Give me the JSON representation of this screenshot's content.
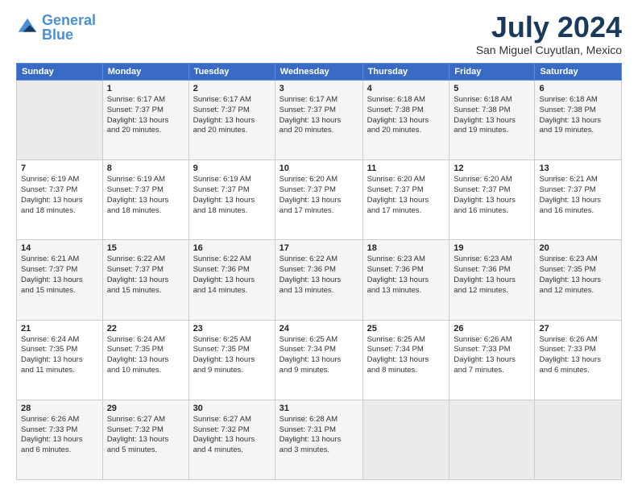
{
  "header": {
    "logo_general": "General",
    "logo_blue": "Blue",
    "month_title": "July 2024",
    "location": "San Miguel Cuyutlan, Mexico"
  },
  "weekdays": [
    "Sunday",
    "Monday",
    "Tuesday",
    "Wednesday",
    "Thursday",
    "Friday",
    "Saturday"
  ],
  "weeks": [
    [
      {
        "day": "",
        "info": ""
      },
      {
        "day": "1",
        "info": "Sunrise: 6:17 AM\nSunset: 7:37 PM\nDaylight: 13 hours\nand 20 minutes."
      },
      {
        "day": "2",
        "info": "Sunrise: 6:17 AM\nSunset: 7:37 PM\nDaylight: 13 hours\nand 20 minutes."
      },
      {
        "day": "3",
        "info": "Sunrise: 6:17 AM\nSunset: 7:37 PM\nDaylight: 13 hours\nand 20 minutes."
      },
      {
        "day": "4",
        "info": "Sunrise: 6:18 AM\nSunset: 7:38 PM\nDaylight: 13 hours\nand 20 minutes."
      },
      {
        "day": "5",
        "info": "Sunrise: 6:18 AM\nSunset: 7:38 PM\nDaylight: 13 hours\nand 19 minutes."
      },
      {
        "day": "6",
        "info": "Sunrise: 6:18 AM\nSunset: 7:38 PM\nDaylight: 13 hours\nand 19 minutes."
      }
    ],
    [
      {
        "day": "7",
        "info": "Sunrise: 6:19 AM\nSunset: 7:37 PM\nDaylight: 13 hours\nand 18 minutes."
      },
      {
        "day": "8",
        "info": "Sunrise: 6:19 AM\nSunset: 7:37 PM\nDaylight: 13 hours\nand 18 minutes."
      },
      {
        "day": "9",
        "info": "Sunrise: 6:19 AM\nSunset: 7:37 PM\nDaylight: 13 hours\nand 18 minutes."
      },
      {
        "day": "10",
        "info": "Sunrise: 6:20 AM\nSunset: 7:37 PM\nDaylight: 13 hours\nand 17 minutes."
      },
      {
        "day": "11",
        "info": "Sunrise: 6:20 AM\nSunset: 7:37 PM\nDaylight: 13 hours\nand 17 minutes."
      },
      {
        "day": "12",
        "info": "Sunrise: 6:20 AM\nSunset: 7:37 PM\nDaylight: 13 hours\nand 16 minutes."
      },
      {
        "day": "13",
        "info": "Sunrise: 6:21 AM\nSunset: 7:37 PM\nDaylight: 13 hours\nand 16 minutes."
      }
    ],
    [
      {
        "day": "14",
        "info": "Sunrise: 6:21 AM\nSunset: 7:37 PM\nDaylight: 13 hours\nand 15 minutes."
      },
      {
        "day": "15",
        "info": "Sunrise: 6:22 AM\nSunset: 7:37 PM\nDaylight: 13 hours\nand 15 minutes."
      },
      {
        "day": "16",
        "info": "Sunrise: 6:22 AM\nSunset: 7:36 PM\nDaylight: 13 hours\nand 14 minutes."
      },
      {
        "day": "17",
        "info": "Sunrise: 6:22 AM\nSunset: 7:36 PM\nDaylight: 13 hours\nand 13 minutes."
      },
      {
        "day": "18",
        "info": "Sunrise: 6:23 AM\nSunset: 7:36 PM\nDaylight: 13 hours\nand 13 minutes."
      },
      {
        "day": "19",
        "info": "Sunrise: 6:23 AM\nSunset: 7:36 PM\nDaylight: 13 hours\nand 12 minutes."
      },
      {
        "day": "20",
        "info": "Sunrise: 6:23 AM\nSunset: 7:35 PM\nDaylight: 13 hours\nand 12 minutes."
      }
    ],
    [
      {
        "day": "21",
        "info": "Sunrise: 6:24 AM\nSunset: 7:35 PM\nDaylight: 13 hours\nand 11 minutes."
      },
      {
        "day": "22",
        "info": "Sunrise: 6:24 AM\nSunset: 7:35 PM\nDaylight: 13 hours\nand 10 minutes."
      },
      {
        "day": "23",
        "info": "Sunrise: 6:25 AM\nSunset: 7:35 PM\nDaylight: 13 hours\nand 9 minutes."
      },
      {
        "day": "24",
        "info": "Sunrise: 6:25 AM\nSunset: 7:34 PM\nDaylight: 13 hours\nand 9 minutes."
      },
      {
        "day": "25",
        "info": "Sunrise: 6:25 AM\nSunset: 7:34 PM\nDaylight: 13 hours\nand 8 minutes."
      },
      {
        "day": "26",
        "info": "Sunrise: 6:26 AM\nSunset: 7:33 PM\nDaylight: 13 hours\nand 7 minutes."
      },
      {
        "day": "27",
        "info": "Sunrise: 6:26 AM\nSunset: 7:33 PM\nDaylight: 13 hours\nand 6 minutes."
      }
    ],
    [
      {
        "day": "28",
        "info": "Sunrise: 6:26 AM\nSunset: 7:33 PM\nDaylight: 13 hours\nand 6 minutes."
      },
      {
        "day": "29",
        "info": "Sunrise: 6:27 AM\nSunset: 7:32 PM\nDaylight: 13 hours\nand 5 minutes."
      },
      {
        "day": "30",
        "info": "Sunrise: 6:27 AM\nSunset: 7:32 PM\nDaylight: 13 hours\nand 4 minutes."
      },
      {
        "day": "31",
        "info": "Sunrise: 6:28 AM\nSunset: 7:31 PM\nDaylight: 13 hours\nand 3 minutes."
      },
      {
        "day": "",
        "info": ""
      },
      {
        "day": "",
        "info": ""
      },
      {
        "day": "",
        "info": ""
      }
    ]
  ]
}
